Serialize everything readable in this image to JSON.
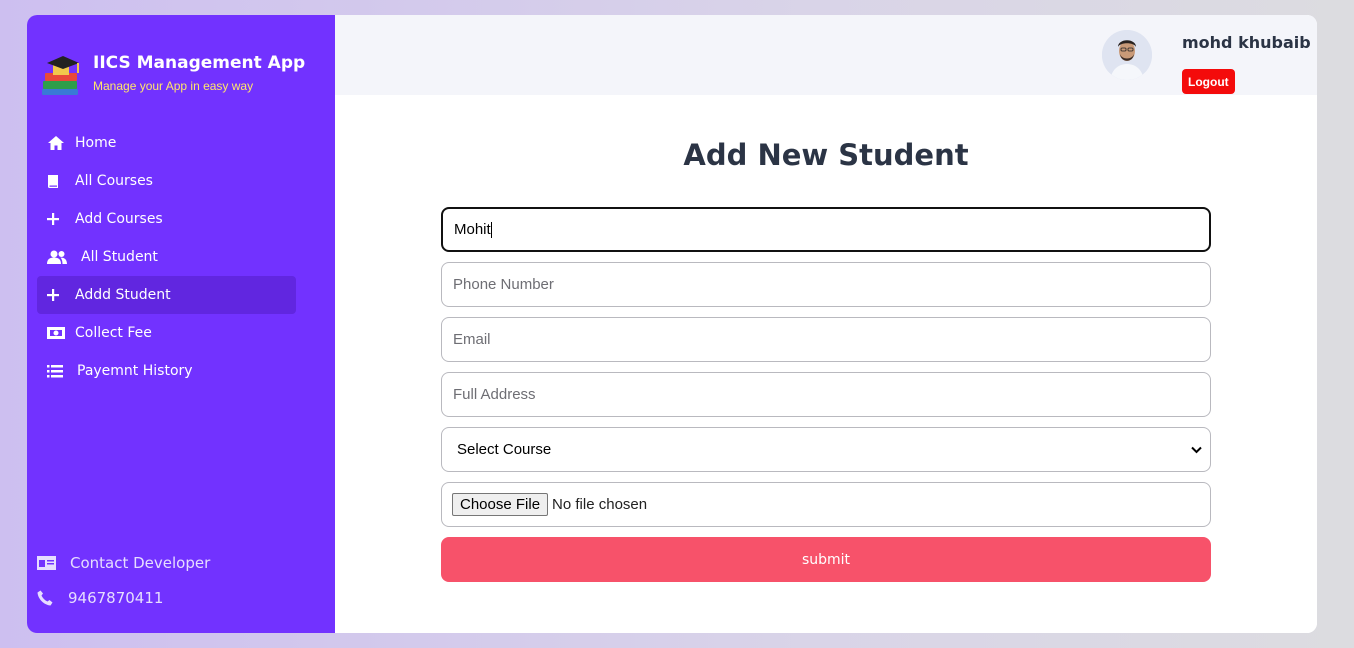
{
  "app": {
    "title": "IICS Management App",
    "subtitle": "Manage your App in easy way",
    "accent_color": "#7232ff",
    "subtitle_color": "#ffe66b"
  },
  "sidebar": {
    "items": [
      {
        "label": "Home",
        "icon": "home-icon"
      },
      {
        "label": "All Courses",
        "icon": "book-icon"
      },
      {
        "label": "Add Courses",
        "icon": "plus-icon"
      },
      {
        "label": "All Student",
        "icon": "users-icon"
      },
      {
        "label": "Addd Student",
        "icon": "plus-icon",
        "active": true
      },
      {
        "label": "Collect Fee",
        "icon": "money-icon"
      },
      {
        "label": "Payemnt History",
        "icon": "list-icon"
      }
    ],
    "contact": {
      "label": "Contact Developer",
      "phone": "9467870411"
    }
  },
  "header": {
    "user_name": "mohd khubaib",
    "logout_label": "Logout",
    "logout_color": "#f40b0b"
  },
  "form": {
    "title": "Add New Student",
    "name_value": "Mohit",
    "phone_placeholder": "Phone Number",
    "email_placeholder": "Email",
    "address_placeholder": "Full Address",
    "course_selected": "Select Course",
    "file_button_label": "Choose File",
    "file_status": "No file chosen",
    "submit_label": "submit",
    "submit_color": "#f7526a"
  }
}
